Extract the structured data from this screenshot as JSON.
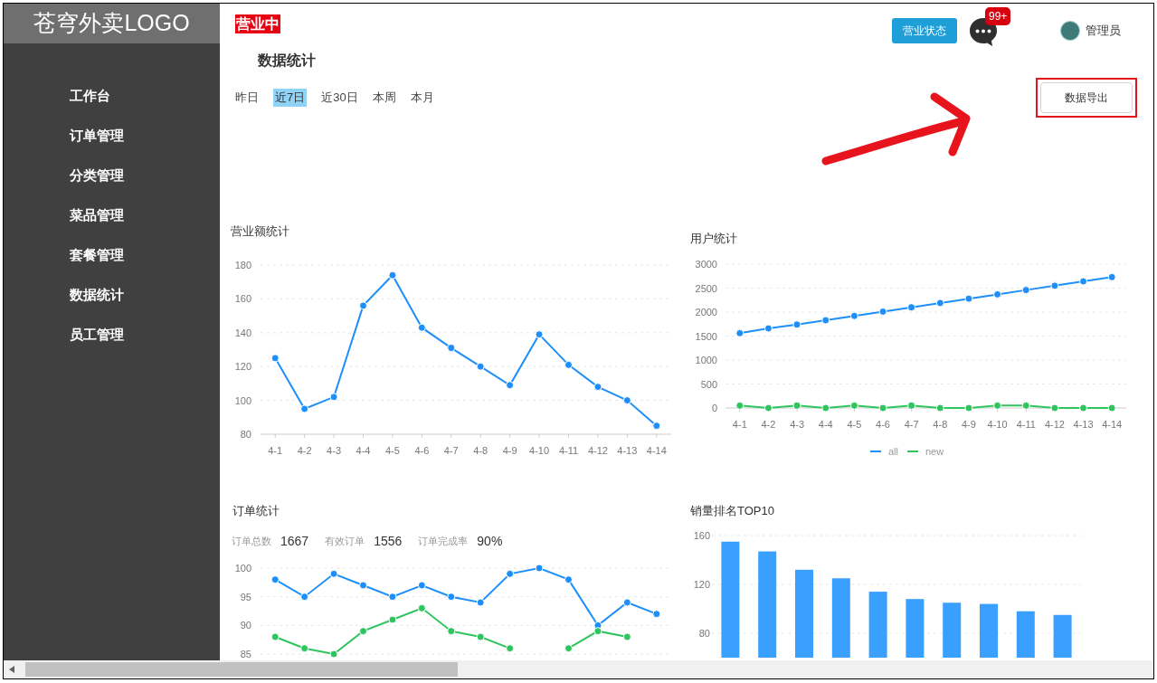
{
  "sidebar": {
    "logo": "苍穹外卖LOGO",
    "items": [
      {
        "label": "工作台"
      },
      {
        "label": "订单管理"
      },
      {
        "label": "分类管理"
      },
      {
        "label": "菜品管理"
      },
      {
        "label": "套餐管理"
      },
      {
        "label": "数据统计"
      },
      {
        "label": "员工管理"
      }
    ]
  },
  "header": {
    "status_badge": "营业中",
    "status_button": "营业状态",
    "notification_count": "99+",
    "user_name": "管理员"
  },
  "page_title": "数据统计",
  "range_tabs": [
    {
      "label": "昨日",
      "selected": false
    },
    {
      "label": "近7日",
      "selected": true
    },
    {
      "label": "近30日",
      "selected": false
    },
    {
      "label": "本周",
      "selected": false
    },
    {
      "label": "本月",
      "selected": false
    }
  ],
  "export_button": "数据导出",
  "revenue_panel": {
    "title": "营业额统计",
    "chart_data": {
      "type": "line",
      "categories": [
        "4-1",
        "4-2",
        "4-3",
        "4-4",
        "4-5",
        "4-6",
        "4-7",
        "4-8",
        "4-9",
        "4-10",
        "4-11",
        "4-12",
        "4-13",
        "4-14"
      ],
      "ylim": [
        80,
        180
      ],
      "yticks": [
        80,
        100,
        120,
        140,
        160,
        180
      ],
      "grid": true,
      "series": [
        {
          "color": "#1e8ffa",
          "marker": true,
          "values": [
            125,
            95,
            102,
            156,
            174,
            143,
            131,
            120,
            109,
            139,
            121,
            108,
            100,
            85
          ]
        }
      ]
    }
  },
  "user_panel": {
    "title": "用户统计",
    "chart_data": {
      "type": "line",
      "categories": [
        "4-1",
        "4-2",
        "4-3",
        "4-4",
        "4-5",
        "4-6",
        "4-7",
        "4-8",
        "4-9",
        "4-10",
        "4-11",
        "4-12",
        "4-13",
        "4-14"
      ],
      "ylim": [
        0,
        3000
      ],
      "yticks": [
        0,
        500,
        1000,
        1500,
        2000,
        2500,
        3000
      ],
      "grid": true,
      "series": [
        {
          "name": "all",
          "color": "#1e8ffa",
          "marker": true,
          "values": [
            1560,
            1660,
            1740,
            1830,
            1920,
            2010,
            2100,
            2190,
            2280,
            2370,
            2460,
            2550,
            2640,
            2730
          ]
        },
        {
          "name": "new",
          "color": "#2ec45e",
          "marker": true,
          "values": [
            50,
            0,
            50,
            0,
            50,
            0,
            50,
            0,
            0,
            50,
            50,
            0,
            0,
            0
          ]
        }
      ]
    }
  },
  "order_panel": {
    "title": "订单统计",
    "stats": [
      {
        "label": "订单总数",
        "value": "1667"
      },
      {
        "label": "有效订单",
        "value": "1556"
      },
      {
        "label": "订单完成率",
        "value": "90%"
      }
    ],
    "chart_data": {
      "type": "line",
      "ylim": [
        85,
        100
      ],
      "yticks": [
        85,
        90,
        95,
        100
      ],
      "grid": true,
      "series": [
        {
          "color": "#1e8ffa",
          "marker": true,
          "values": [
            98,
            95,
            99,
            97,
            95,
            97,
            95,
            94,
            99,
            100,
            98,
            90,
            94,
            92
          ]
        },
        {
          "color": "#2ec45e",
          "marker": true,
          "values": [
            88,
            86,
            85,
            89,
            91,
            93,
            89,
            88,
            86,
            null,
            86,
            89,
            88,
            null
          ]
        }
      ]
    }
  },
  "sales_panel": {
    "title": "销量排名TOP10",
    "chart_data": {
      "type": "bar",
      "ylim": [
        60,
        160
      ],
      "yticks": [
        80,
        120,
        160
      ],
      "grid": true,
      "series": [
        {
          "color": "#3aa0ff",
          "values": [
            155,
            147,
            132,
            125,
            114,
            108,
            105,
            104,
            98,
            95
          ]
        }
      ]
    }
  }
}
